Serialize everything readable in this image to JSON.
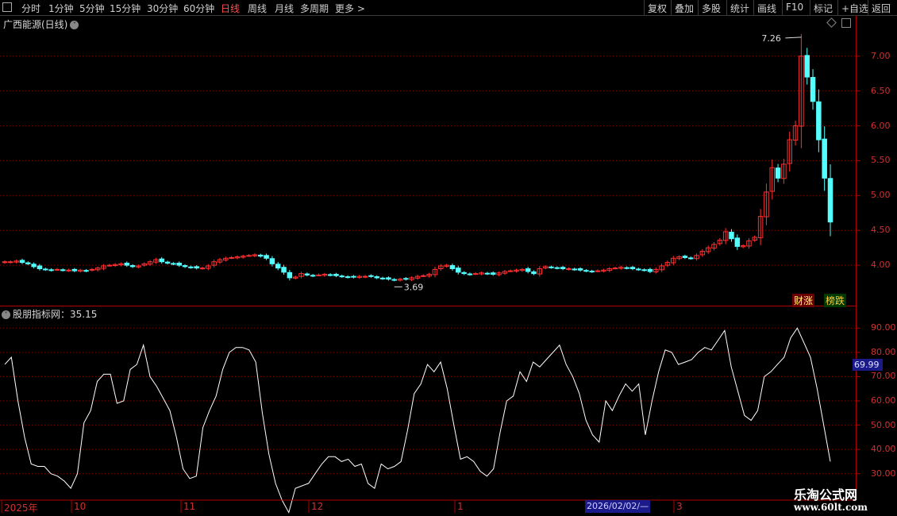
{
  "toolbar": {
    "periods": [
      "分时",
      "1分钟",
      "5分钟",
      "15分钟",
      "30分钟",
      "60分钟",
      "日线",
      "周线",
      "月线",
      "多周期",
      "更多 >"
    ],
    "active_period": "日线",
    "right_buttons": [
      "复权",
      "叠加",
      "多股",
      "统计",
      "画线",
      "F10",
      "标记",
      "+自选",
      "返回"
    ]
  },
  "main_panel": {
    "title": "广西能源(日线)",
    "high_marker": "7.26",
    "low_marker": "3.69",
    "badges": [
      "财涨",
      "榜跌"
    ]
  },
  "indicator_panel": {
    "title": "股朋指标网：35.15",
    "current_value_box": "69.99"
  },
  "x_axis": {
    "labels": [
      "2025年",
      "10",
      "11",
      "12",
      "1",
      "3"
    ],
    "cursor_date": "2026/02/02/—"
  },
  "watermark": {
    "line1": "乐淘公式网",
    "line2": "www.60lt.com"
  },
  "colors": {
    "up": "#ff3030",
    "down": "#54ffff",
    "grid": "#8a0000",
    "line": "#ffffff"
  },
  "chart_data": [
    {
      "type": "candlestick",
      "title": "广西能源(日线)",
      "yticks": [
        4.0,
        4.5,
        5.0,
        5.5,
        6.0,
        6.5,
        7.0
      ],
      "ylim": [
        3.5,
        7.35
      ],
      "annotations": [
        {
          "label": "7.26",
          "kind": "high"
        },
        {
          "label": "3.69",
          "kind": "low"
        }
      ],
      "closes": [
        4.05,
        4.05,
        4.06,
        4.04,
        4.02,
        3.98,
        3.95,
        3.94,
        3.93,
        3.94,
        3.93,
        3.93,
        3.92,
        3.93,
        3.92,
        3.94,
        3.96,
        3.99,
        4.0,
        4.01,
        4.02,
        4.0,
        3.98,
        3.99,
        4.02,
        4.05,
        4.08,
        4.05,
        4.03,
        4.02,
        4.0,
        3.98,
        3.97,
        3.96,
        3.96,
        3.99,
        4.05,
        4.08,
        4.1,
        4.11,
        4.12,
        4.13,
        4.14,
        4.15,
        4.13,
        4.1,
        4.02,
        3.96,
        3.9,
        3.82,
        3.83,
        3.88,
        3.86,
        3.85,
        3.86,
        3.87,
        3.86,
        3.85,
        3.84,
        3.83,
        3.83,
        3.84,
        3.84,
        3.84,
        3.82,
        3.81,
        3.8,
        3.79,
        3.8,
        3.8,
        3.82,
        3.84,
        3.85,
        3.87,
        3.94,
        3.99,
        4.0,
        3.95,
        3.9,
        3.88,
        3.87,
        3.88,
        3.89,
        3.88,
        3.87,
        3.89,
        3.91,
        3.92,
        3.93,
        3.94,
        3.91,
        3.88,
        3.95,
        3.98,
        3.97,
        3.96,
        3.95,
        3.95,
        3.94,
        3.93,
        3.92,
        3.91,
        3.92,
        3.93,
        3.95,
        3.96,
        3.97,
        3.96,
        3.95,
        3.94,
        3.93,
        3.91,
        3.94,
        3.99,
        4.04,
        4.1,
        4.12,
        4.11,
        4.1,
        4.14,
        4.2,
        4.25,
        4.3,
        4.36,
        4.48,
        4.38,
        4.27,
        4.28,
        4.35,
        4.4,
        4.7,
        5.05,
        5.4,
        5.25,
        5.45,
        5.8,
        6.0,
        7.0,
        6.7,
        6.35,
        5.8,
        5.25,
        4.62
      ]
    },
    {
      "type": "line",
      "title": "股朋指标网",
      "yticks": [
        30,
        40,
        50,
        60,
        70,
        80,
        90
      ],
      "ylim": [
        25,
        95
      ],
      "values": [
        75,
        78,
        60,
        45,
        34,
        33,
        33,
        30,
        29,
        27,
        24,
        30,
        51,
        56,
        68,
        71,
        71,
        59,
        60,
        73,
        75,
        83,
        70,
        66,
        61,
        56,
        45,
        32,
        28,
        29,
        49,
        56,
        62,
        73,
        80,
        82,
        82,
        81,
        76,
        55,
        38,
        26,
        19,
        14,
        24,
        25,
        26,
        30,
        34,
        37,
        37,
        35,
        36,
        33,
        34,
        26,
        24,
        34,
        32,
        33,
        35,
        48,
        63,
        67,
        75,
        72,
        76,
        65,
        50,
        36,
        37,
        35,
        31,
        29,
        32,
        47,
        60,
        62,
        72,
        68,
        76,
        74,
        77,
        80,
        83,
        75,
        70,
        63,
        52,
        46,
        43,
        60,
        56,
        62,
        67,
        64,
        67,
        46,
        60,
        72,
        81,
        80,
        75,
        76,
        77,
        80,
        82,
        81,
        85,
        89,
        74,
        64,
        54,
        52,
        56,
        70,
        72,
        75,
        78,
        86,
        90,
        84,
        78,
        65,
        50,
        35
      ]
    }
  ]
}
